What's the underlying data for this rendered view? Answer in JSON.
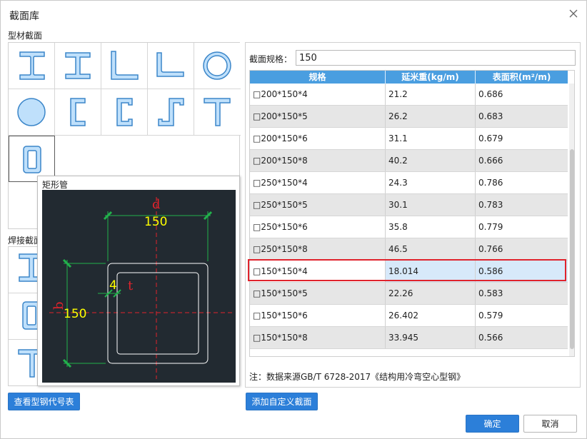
{
  "dialog": {
    "title": "截面库"
  },
  "left": {
    "shape_section_label": "型材截面",
    "welded_section_label": "焊接截面",
    "shape_icons": [
      "i-beam-icon",
      "h-section-icon",
      "equal-angle-icon",
      "unequal-angle-icon",
      "circular-tube-icon",
      "round-bar-icon",
      "channel-icon",
      "lipped-channel-icon",
      "z-section-icon",
      "t-section-icon",
      "rectangular-tube-icon"
    ],
    "view_code_table_button": "查看型钢代号表"
  },
  "preview": {
    "title": "矩形管",
    "dim_d_label": "d",
    "dim_d_value": "150",
    "dim_b_label": "b",
    "dim_b_value": "150",
    "dim_t_label": "t",
    "dim_t_value": "4"
  },
  "right": {
    "spec_label": "截面规格：",
    "spec_value": "150",
    "columns": [
      "规格",
      "延米重(kg/m)",
      "表面积(m²/m)"
    ],
    "rows": [
      {
        "spec": "□200*150*4",
        "weight": "21.2",
        "area": "0.686"
      },
      {
        "spec": "□200*150*5",
        "weight": "26.2",
        "area": "0.683"
      },
      {
        "spec": "□200*150*6",
        "weight": "31.1",
        "area": "0.679"
      },
      {
        "spec": "□200*150*8",
        "weight": "40.2",
        "area": "0.666"
      },
      {
        "spec": "□250*150*4",
        "weight": "24.3",
        "area": "0.786"
      },
      {
        "spec": "□250*150*5",
        "weight": "30.1",
        "area": "0.783"
      },
      {
        "spec": "□250*150*6",
        "weight": "35.8",
        "area": "0.779"
      },
      {
        "spec": "□250*150*8",
        "weight": "46.5",
        "area": "0.766"
      },
      {
        "spec": "□150*150*4",
        "weight": "18.014",
        "area": "0.586"
      },
      {
        "spec": "□150*150*5",
        "weight": "22.26",
        "area": "0.583"
      },
      {
        "spec": "□150*150*6",
        "weight": "26.402",
        "area": "0.579"
      },
      {
        "spec": "□150*150*8",
        "weight": "33.945",
        "area": "0.566"
      }
    ],
    "selected_row": 8,
    "note": "注：数据来源GB/T 6728-2017《结构用冷弯空心型钢》",
    "add_custom_button": "添加自定义截面"
  },
  "footer": {
    "ok": "确定",
    "cancel": "取消"
  },
  "colors": {
    "accent": "#2c7fd9",
    "header": "#4a9ee0",
    "highlight_border": "#e0232c",
    "icon_fill": "#bfe0fb",
    "icon_stroke": "#3b86c9",
    "preview_bg": "#222a31"
  }
}
